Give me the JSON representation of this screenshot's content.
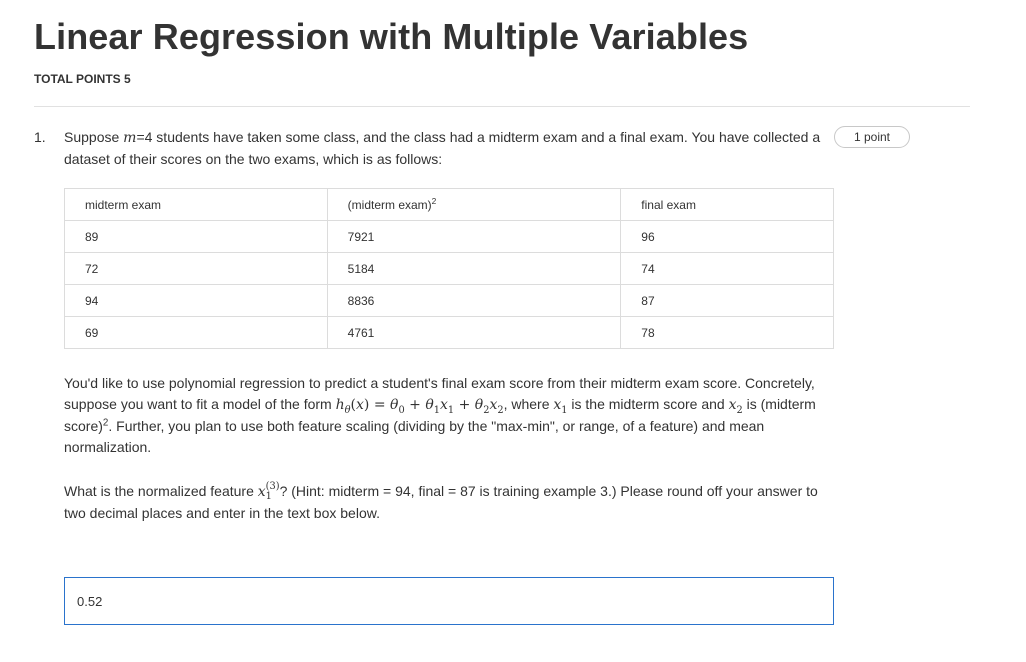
{
  "page": {
    "title": "Linear Regression with Multiple Variables",
    "total_points": "TOTAL POINTS 5"
  },
  "question": {
    "number": "1.",
    "points": "1 point",
    "intro_prefix": "Suppose ",
    "intro_var": "m",
    "intro_rest": "=4 students have taken some class, and the class had a midterm exam and a final exam. You have collected a dataset of their scores on the two exams, which is as follows:",
    "table": {
      "headers": [
        "midterm exam",
        "(midterm exam)",
        "final exam"
      ],
      "header_sup": "2",
      "rows": [
        [
          "89",
          "7921",
          "96"
        ],
        [
          "72",
          "5184",
          "74"
        ],
        [
          "94",
          "8836",
          "87"
        ],
        [
          "69",
          "4761",
          "78"
        ]
      ]
    },
    "poly": {
      "part1": "You'd like to use polynomial regression to predict a student's final exam score from their midterm exam score. Concretely, suppose you want to fit a model of the form ",
      "part2": ", where ",
      "part3": " is the midterm score and ",
      "part4": " is (midterm score)",
      "part4_sup": "2",
      "part5": ". Further, you plan to use both feature scaling (dividing by the \"max-min\", or range, of a feature) and mean normalization."
    },
    "ask": {
      "part1": "What is the normalized feature ",
      "part2": "? (Hint: midterm = 94, final = 87 is training example 3.) Please round off your answer to two decimal places and enter in the text box below."
    },
    "answer_value": "0.52"
  }
}
